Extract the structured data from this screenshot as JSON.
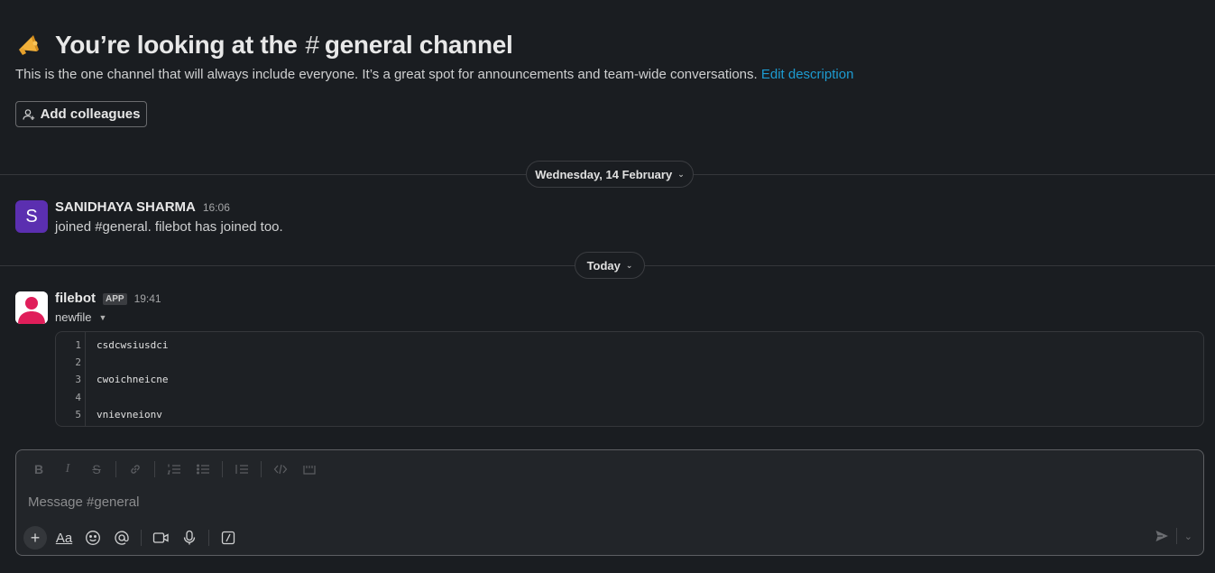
{
  "channel_intro": {
    "title_prefix": "You’re looking at the",
    "hash": "#",
    "channel_name": "general channel",
    "description": "This is the one channel that will always include everyone. It’s a great spot for announcements and team-wide conversations.",
    "edit_description_link": "Edit description",
    "add_colleagues_label": "Add colleagues"
  },
  "date_dividers": [
    {
      "label": "Wednesday, 14 February"
    },
    {
      "label": "Today"
    }
  ],
  "messages": [
    {
      "author": "SANIDHAYA SHARMA",
      "avatar_letter": "S",
      "time": "16:06",
      "text": "joined #general. filebot has joined too."
    },
    {
      "author": "filebot",
      "badge": "APP",
      "time": "19:41",
      "file_name": "newfile",
      "file_lines": [
        {
          "number": "1",
          "text": "csdcwsiusdci"
        },
        {
          "number": "2",
          "text": ""
        },
        {
          "number": "3",
          "text": "cwoichneicne"
        },
        {
          "number": "4",
          "text": ""
        },
        {
          "number": "5",
          "text": "vnievneionv"
        }
      ]
    }
  ],
  "composer": {
    "placeholder": "Message #general",
    "format_toolbar": [
      "bold-icon",
      "italic-icon",
      "strikethrough-icon",
      "link-icon",
      "ordered-list-icon",
      "bulleted-list-icon",
      "blockquote-icon",
      "code-icon",
      "code-block-icon"
    ],
    "actions": [
      "plus-icon",
      "format-text-icon",
      "emoji-icon",
      "mention-icon",
      "video-icon",
      "microphone-icon",
      "slash-command-icon"
    ],
    "format_label": "Aa"
  },
  "colors": {
    "background": "#1a1d21",
    "link": "#1d9bd1",
    "avatar_s": "#5b2fb0",
    "bot_avatar": "#e01e5a"
  }
}
